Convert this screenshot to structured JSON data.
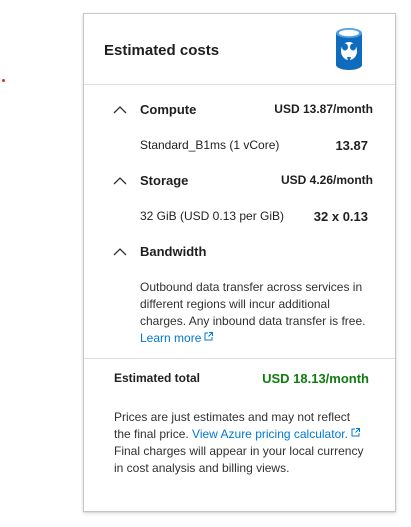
{
  "panel": {
    "title": "Estimated costs",
    "icon": "postgresql-database-icon"
  },
  "compute": {
    "name": "Compute",
    "price": "USD 13.87/month",
    "item_label": "Standard_B1ms (1 vCore)",
    "item_value": "13.87"
  },
  "storage": {
    "name": "Storage",
    "price": "USD 4.26/month",
    "item_label": "32 GiB (USD 0.13 per GiB)",
    "item_value": "32 x 0.13"
  },
  "bandwidth": {
    "name": "Bandwidth",
    "note": "Outbound data transfer across services in different regions will incur additional charges. Any inbound data transfer is free. ",
    "link_text": "Learn more"
  },
  "total": {
    "label": "Estimated total",
    "value": "USD 18.13/month",
    "color": "#107c10"
  },
  "footer": {
    "note_before_link": "Prices are just estimates and may not reflect the final price. ",
    "link_text": "View Azure pricing calculator.",
    "note_after_link": "Final charges will appear in your local currency in cost analysis and billing views."
  },
  "colors": {
    "accent_link": "#0078d4",
    "red_marker": "#d13438"
  }
}
